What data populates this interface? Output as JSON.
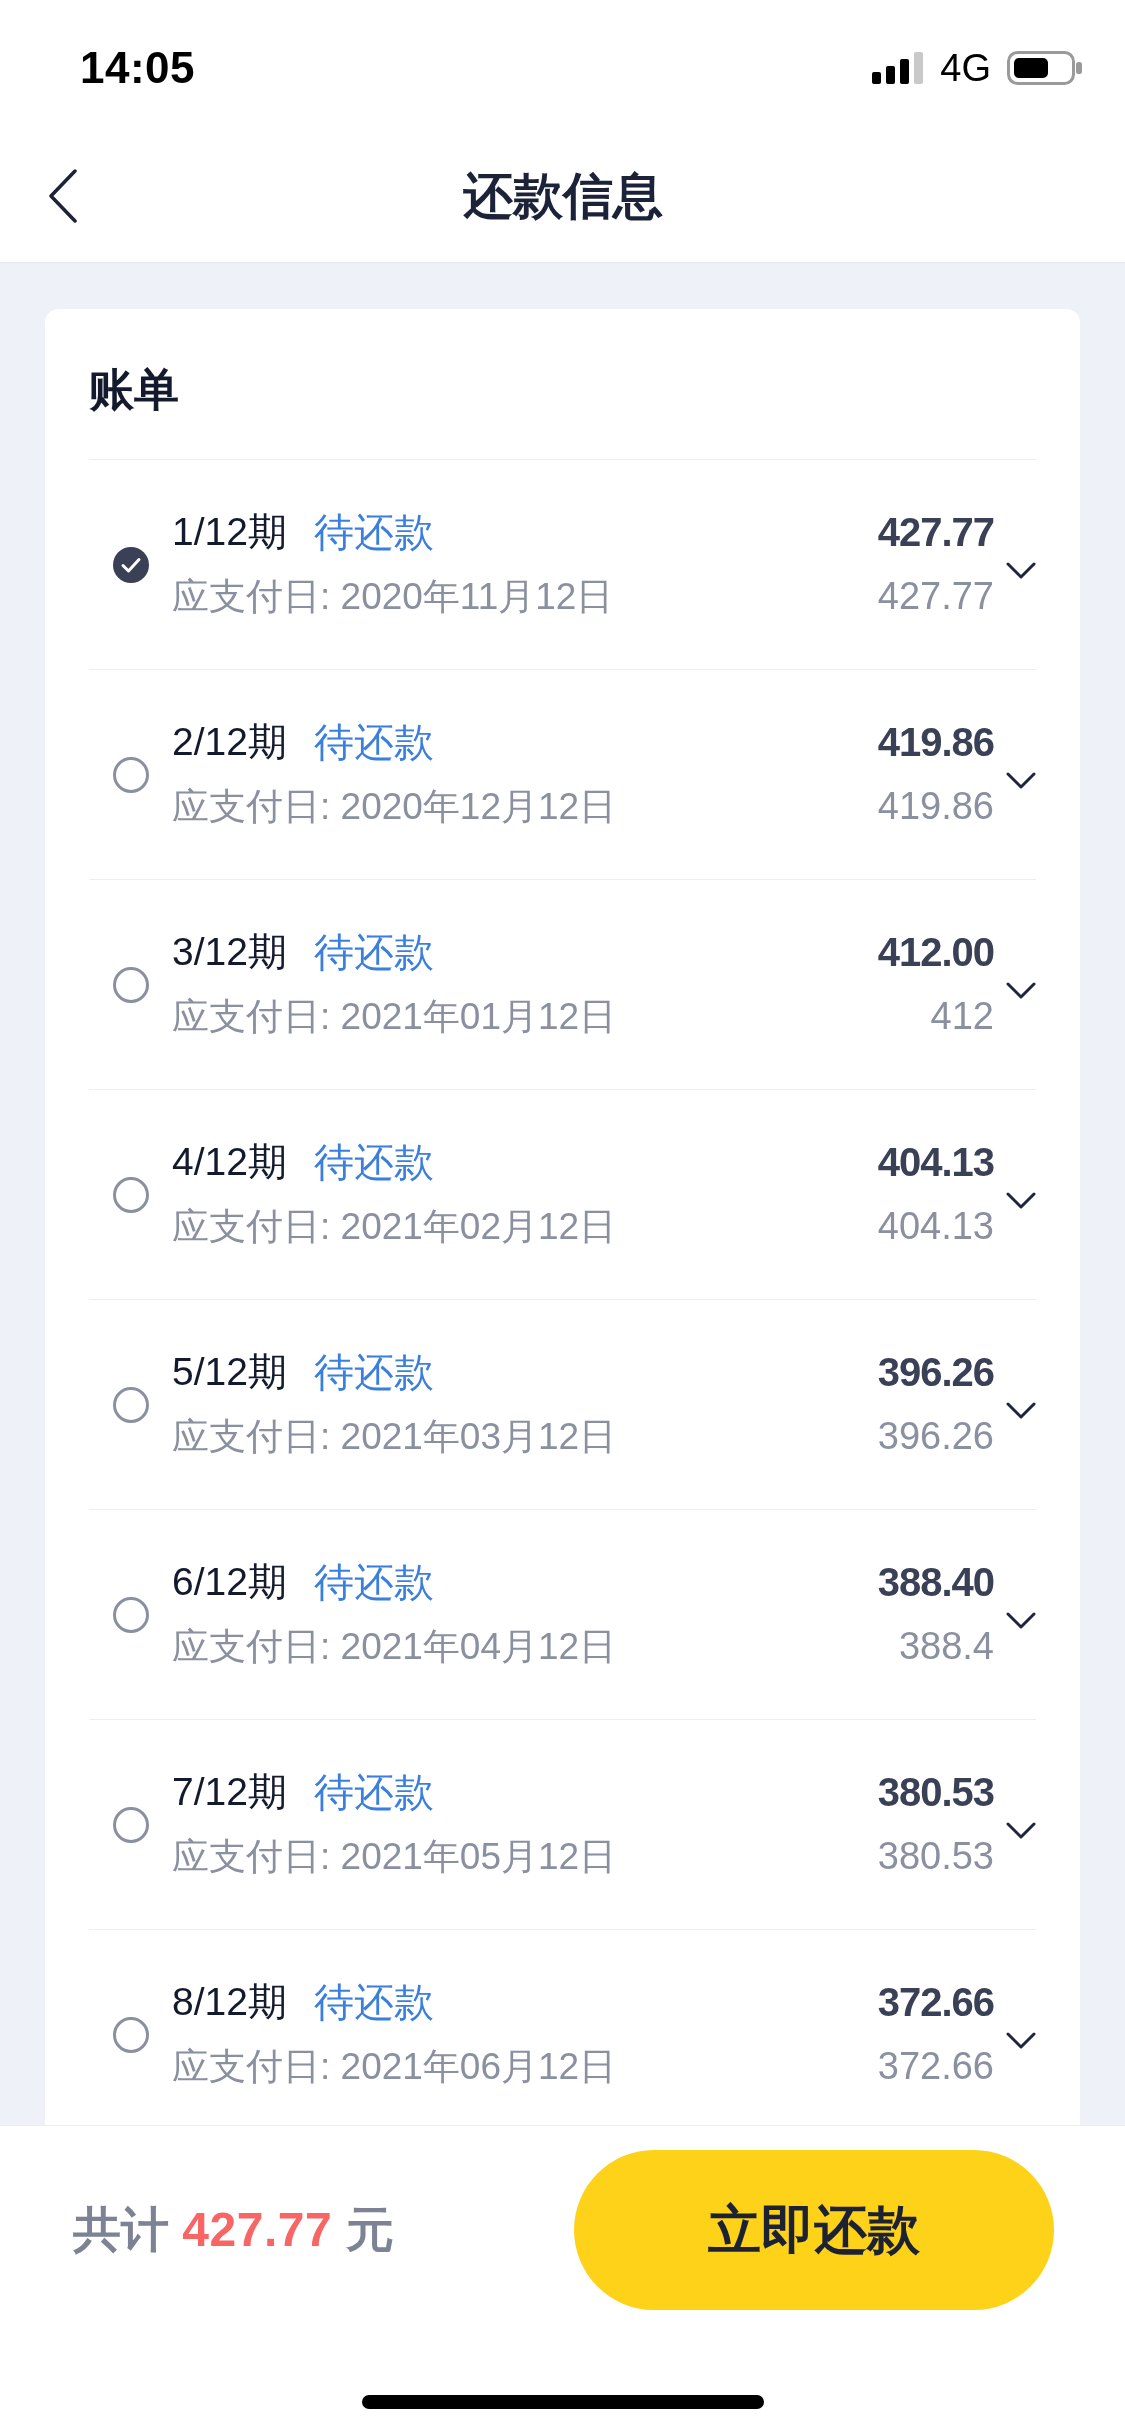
{
  "status_bar": {
    "time": "14:05",
    "network": "4G"
  },
  "nav": {
    "title": "还款信息"
  },
  "bill": {
    "title": "账单",
    "items": [
      {
        "period": "1/12期",
        "status": "待还款",
        "due_date": "应支付日: 2020年11月12日",
        "amount": "427.77",
        "sub_amount": "427.77",
        "selected": true
      },
      {
        "period": "2/12期",
        "status": "待还款",
        "due_date": "应支付日: 2020年12月12日",
        "amount": "419.86",
        "sub_amount": "419.86",
        "selected": false
      },
      {
        "period": "3/12期",
        "status": "待还款",
        "due_date": "应支付日: 2021年01月12日",
        "amount": "412.00",
        "sub_amount": "412",
        "selected": false
      },
      {
        "period": "4/12期",
        "status": "待还款",
        "due_date": "应支付日: 2021年02月12日",
        "amount": "404.13",
        "sub_amount": "404.13",
        "selected": false
      },
      {
        "period": "5/12期",
        "status": "待还款",
        "due_date": "应支付日: 2021年03月12日",
        "amount": "396.26",
        "sub_amount": "396.26",
        "selected": false
      },
      {
        "period": "6/12期",
        "status": "待还款",
        "due_date": "应支付日: 2021年04月12日",
        "amount": "388.40",
        "sub_amount": "388.4",
        "selected": false
      },
      {
        "period": "7/12期",
        "status": "待还款",
        "due_date": "应支付日: 2021年05月12日",
        "amount": "380.53",
        "sub_amount": "380.53",
        "selected": false
      },
      {
        "period": "8/12期",
        "status": "待还款",
        "due_date": "应支付日: 2021年06月12日",
        "amount": "372.66",
        "sub_amount": "372.66",
        "selected": false
      }
    ]
  },
  "footer": {
    "total_label": "共计",
    "total_amount": "427.77",
    "total_unit": "元",
    "pay_button": "立即还款"
  }
}
